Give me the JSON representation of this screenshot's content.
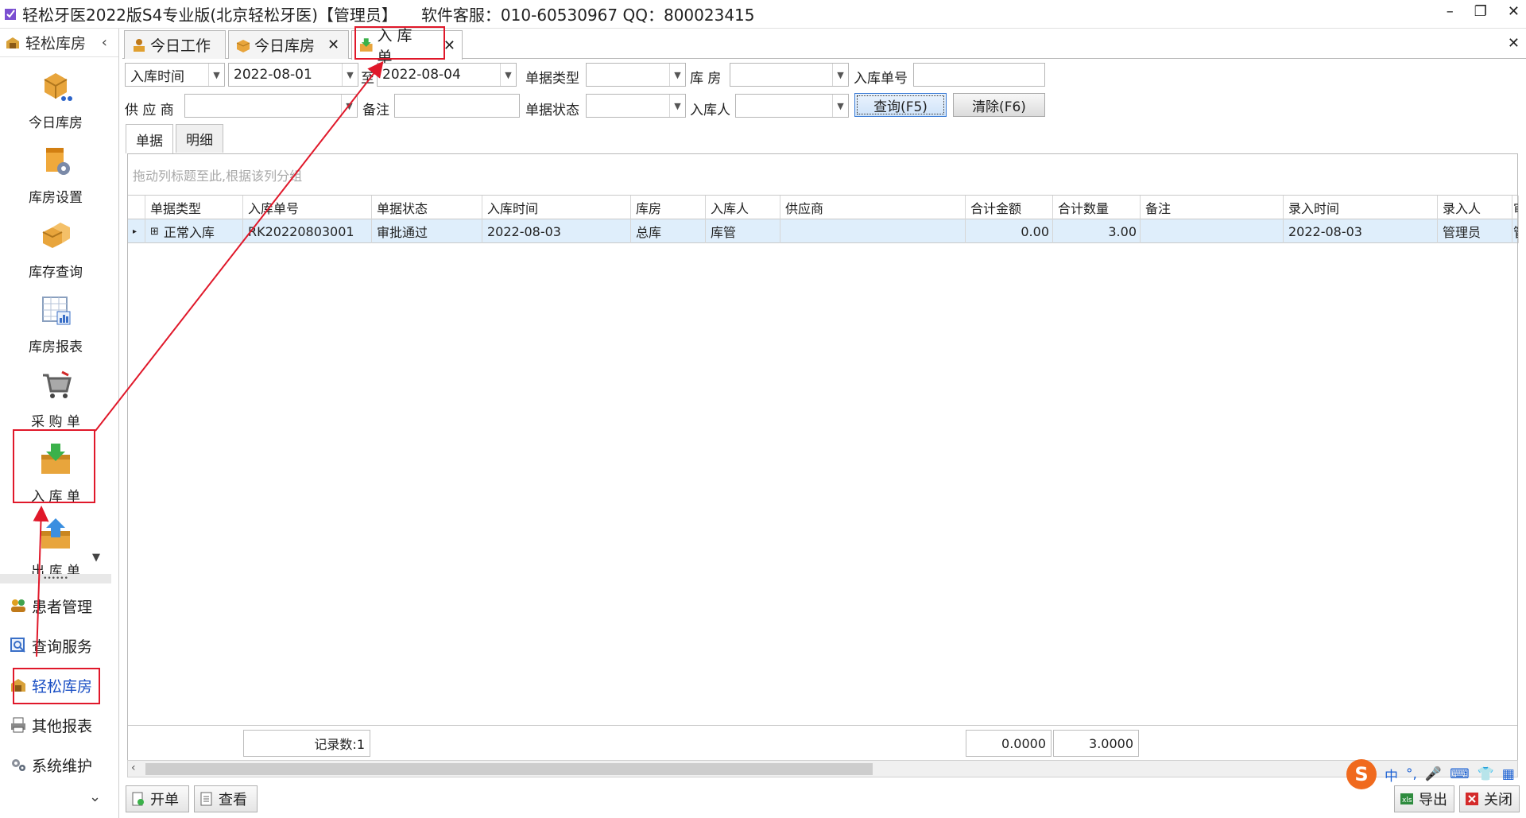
{
  "window": {
    "title": "轻松牙医2022版S4专业版(北京轻松牙医)【管理员】",
    "support": "软件客服：010-60530967 QQ：800023415",
    "minimize": "–",
    "restore": "❐",
    "close": "✕"
  },
  "sidebar": {
    "header": "轻松库房",
    "collapse_glyph": "‹",
    "tiles": [
      {
        "label": "今日库房",
        "icon": "boxes-cart-icon"
      },
      {
        "label": "库房设置",
        "icon": "warehouse-settings-icon"
      },
      {
        "label": "库存查询",
        "icon": "stock-query-icon"
      },
      {
        "label": "库房报表",
        "icon": "report-chart-icon"
      },
      {
        "label": "采 购 单",
        "icon": "shopping-cart-icon"
      },
      {
        "label": "入 库 单",
        "icon": "inbound-tray-icon"
      },
      {
        "label": "出 库 单",
        "icon": "outbound-tray-icon"
      }
    ],
    "splitter_dots": "••••••",
    "list": [
      {
        "label": "患者管理",
        "icon": "patients-icon"
      },
      {
        "label": "查询服务",
        "icon": "search-icon"
      },
      {
        "label": "轻松库房",
        "icon": "warehouse-icon"
      },
      {
        "label": "其他报表",
        "icon": "printer-icon"
      },
      {
        "label": "系统维护",
        "icon": "gears-icon"
      }
    ],
    "more_glyph": "⌄"
  },
  "tabs": [
    {
      "label": "今日工作",
      "closable": false
    },
    {
      "label": "今日库房",
      "closable": true
    },
    {
      "label": "入 库 单",
      "closable": true
    }
  ],
  "close_all_glyph": "✕",
  "filters": {
    "date_type": "入库时间",
    "date_from": "2022-08-01",
    "to_label": "至",
    "date_to": "2022-08-04",
    "doc_type_label": "单据类型",
    "doc_type": "",
    "warehouse_label": "库  房",
    "warehouse": "",
    "doc_no_label": "入库单号",
    "doc_no": "",
    "supplier_label": "供 应 商",
    "supplier": "",
    "remark_label": "备注",
    "remark": "",
    "status_label": "单据状态",
    "status": "",
    "operator_label": "入库人",
    "operator": "",
    "query_button": "查询(F5)",
    "clear_button": "清除(F6)"
  },
  "subtabs": [
    "单据",
    "明细"
  ],
  "grid": {
    "group_hint": "拖动列标题至此,根据该列分组",
    "columns": [
      "单据类型",
      "入库单号",
      "单据状态",
      "入库时间",
      "库房",
      "入库人",
      "供应商",
      "合计金额",
      "合计数量",
      "备注",
      "录入时间",
      "录入人",
      "审"
    ],
    "rows": [
      [
        "正常入库",
        "RK20220803001",
        "审批通过",
        "2022-08-03",
        "总库",
        "库管",
        "",
        "0.00",
        "3.00",
        "",
        "2022-08-03",
        "管理员",
        "管"
      ]
    ],
    "footer": {
      "count": "记录数:1",
      "amount_total": "0.0000",
      "qty_total": "3.0000"
    }
  },
  "bottom": {
    "new_button": "开单",
    "view_button": "查看",
    "export_button": "导出",
    "close_button": "关闭"
  },
  "ime": {
    "logo": "S",
    "lang": "中",
    "punct": "°,",
    "mic": "🎤",
    "keyboard": "⌨",
    "skin": "👕",
    "grid": "▦"
  },
  "colors": {
    "highlight_box": "#e0182a",
    "selected_row": "#dfeefb",
    "active_nav": "#1a4fc4"
  }
}
